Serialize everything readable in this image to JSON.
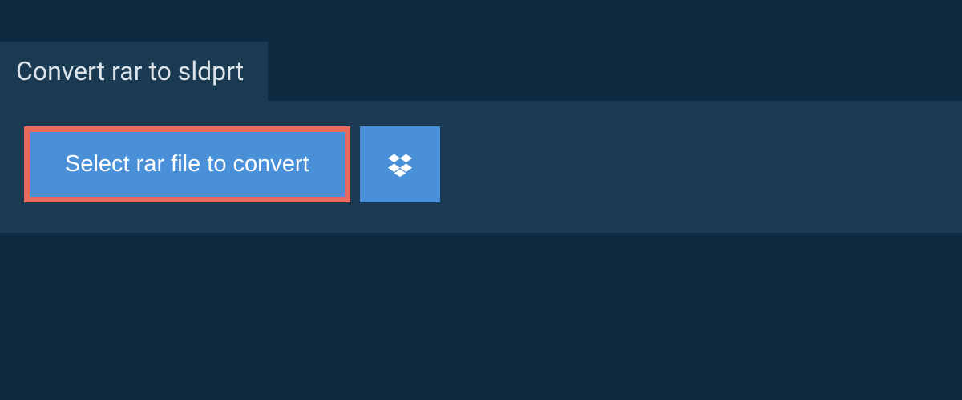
{
  "header": {
    "title": "Convert rar to sldprt"
  },
  "actions": {
    "select_file_label": "Select rar file to convert",
    "dropbox_icon": "dropbox-icon"
  },
  "colors": {
    "background": "#0e2a40",
    "panel": "#1a3a52",
    "button": "#4a90d9",
    "highlight_border": "#e86a5c"
  }
}
